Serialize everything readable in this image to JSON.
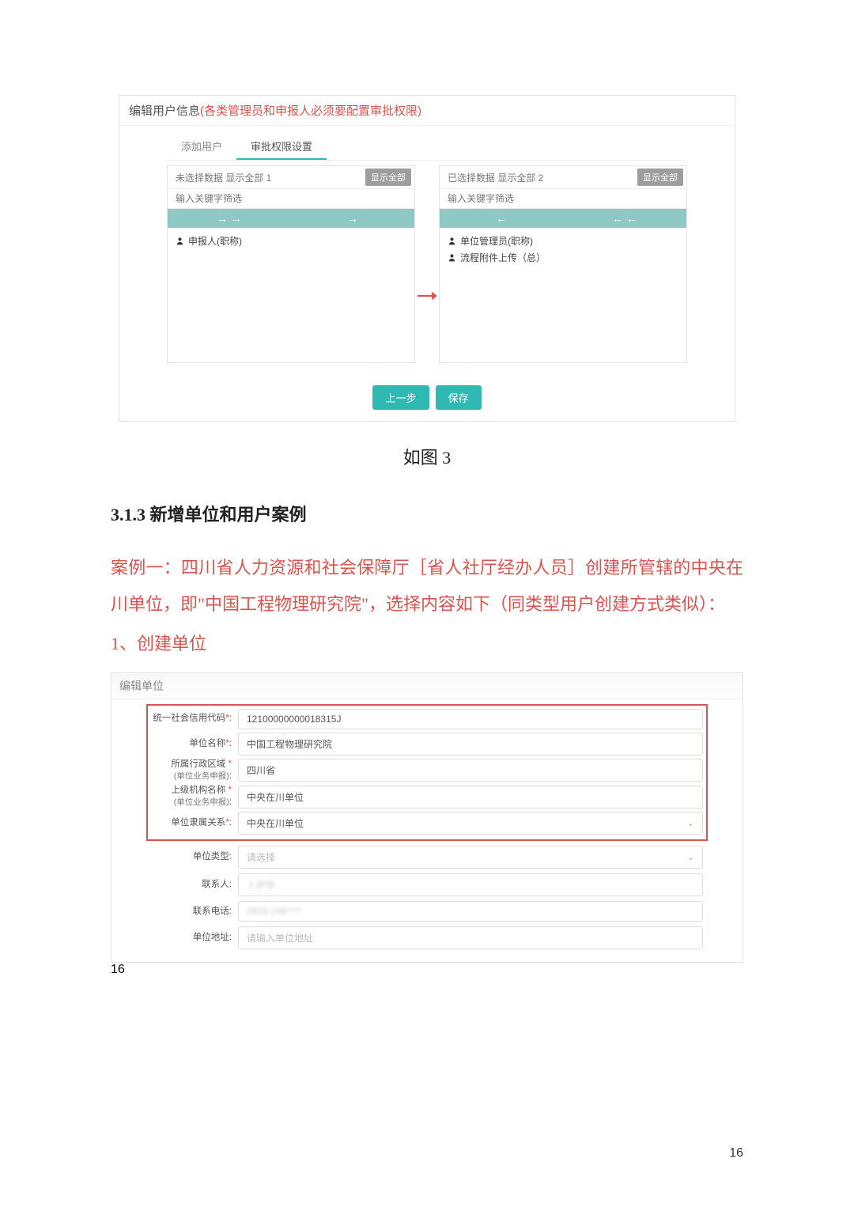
{
  "dialog": {
    "title_prefix": "编辑用户信息",
    "title_suffix": "(各类管理员和申报人必须要配置审批权限)",
    "tabs": {
      "add_user": "添加用户",
      "perm": "审批权限设置"
    },
    "left": {
      "head": "未选择数据 显示全部 1",
      "show_all": "显示全部",
      "filter_ph": "输入关键字筛选",
      "item1": "申报人(职称)"
    },
    "right": {
      "head": "已选择数据 显示全部 2",
      "show_all": "显示全部",
      "filter_ph": "输入关键字筛选",
      "item1": "单位管理员(职称)",
      "item2": "流程附件上传（总）"
    },
    "prev": "上一步",
    "save": "保存"
  },
  "caption3": "如图 3",
  "heading": "3.1.3 新增单位和用户案例",
  "para1": "案例一：四川省人力资源和社会保障厅［省人社厅经办人员］创建所管辖的中央在川单位，即\"中国工程物理研究院\"，选择内容如下（同类型用户创建方式类似）：",
  "para2": "1、创建单位",
  "form": {
    "title": "编辑单位",
    "f1_label": "统一社会信用代码",
    "f1_value": "12100000000018315J",
    "f2_label": "单位名称",
    "f2_value": "中国工程物理研究院",
    "f3_label": "所属行政区域",
    "f3_sub": "(单位业务申报)",
    "f3_value": "四川省",
    "f4_label": "上级机构名称",
    "f4_sub": "(单位业务申报)",
    "f4_value": "中央在川单位",
    "f5_label": "单位隶属关系",
    "f5_value": "中央在川单位",
    "f6_label": "单位类型",
    "f6_value": "请选择",
    "f7_label": "联系人",
    "f7_value": "",
    "f8_label": "联系电话",
    "f8_value": "",
    "f9_label": "单位地址",
    "f9_value": "请输入单位地址",
    "colon": ":"
  },
  "page_number": "16"
}
